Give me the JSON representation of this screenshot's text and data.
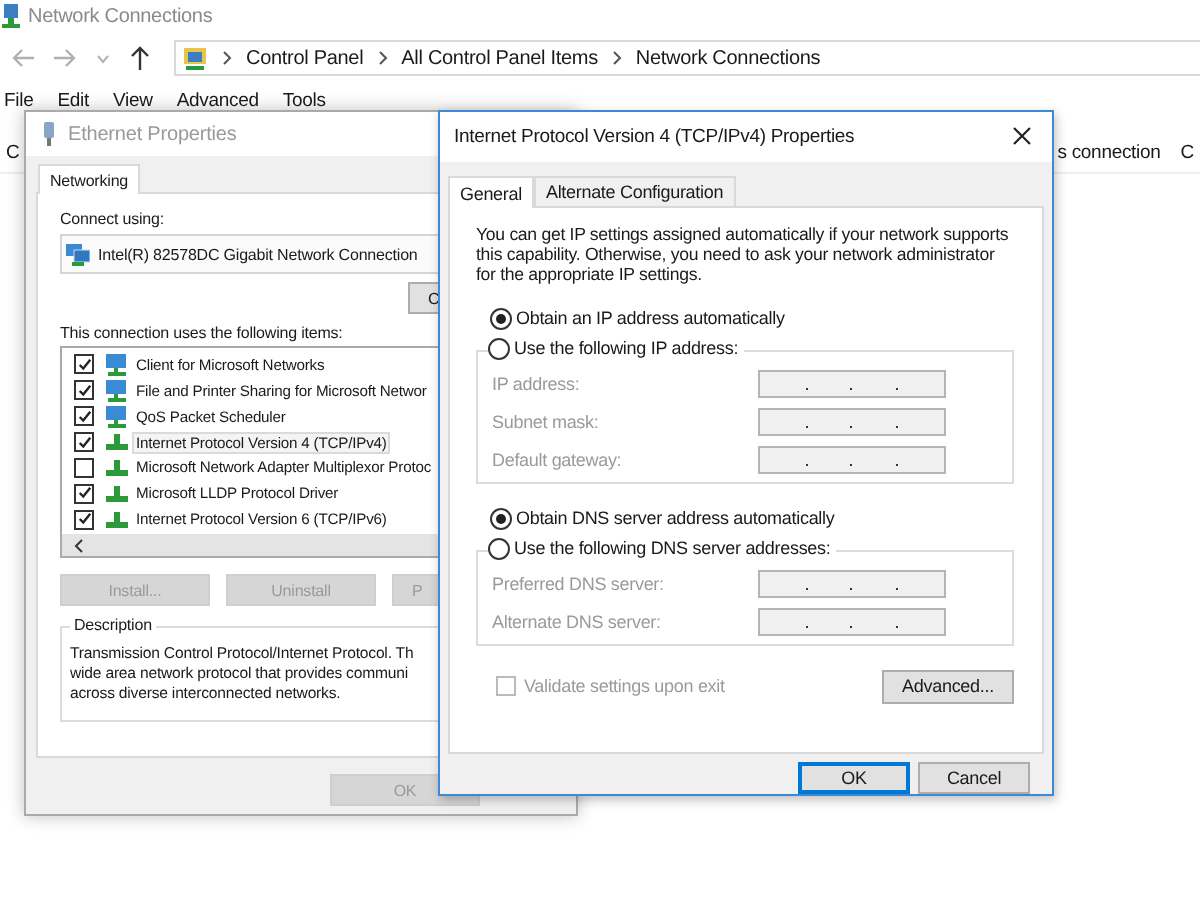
{
  "explorer": {
    "title": "Network Connections",
    "breadcrumb": [
      "Control Panel",
      "All Control Panel Items",
      "Network Connections"
    ],
    "menu": [
      "File",
      "Edit",
      "View",
      "Advanced",
      "Tools"
    ],
    "toolbar_left": "C",
    "toolbar_right": [
      "s connection",
      "C"
    ]
  },
  "ethernet_dialog": {
    "title": "Ethernet Properties",
    "tabs": [
      {
        "label": "Networking",
        "selected": true
      }
    ],
    "connect_label": "Connect using:",
    "adapter": "Intel(R) 82578DC Gigabit Network Connection",
    "configure_button": "C",
    "items_label": "This connection uses the following items:",
    "items": [
      {
        "kind": "service",
        "label": "Client for Microsoft Networks",
        "checked": true,
        "selected": false
      },
      {
        "kind": "service",
        "label": "File and Printer Sharing for Microsoft Networ",
        "checked": true,
        "selected": false
      },
      {
        "kind": "service",
        "label": "QoS Packet Scheduler",
        "checked": true,
        "selected": false
      },
      {
        "kind": "protocol",
        "label": "Internet Protocol Version 4 (TCP/IPv4)",
        "checked": true,
        "selected": true
      },
      {
        "kind": "protocol",
        "label": "Microsoft Network Adapter Multiplexor Protoc",
        "checked": false,
        "selected": false
      },
      {
        "kind": "protocol",
        "label": "Microsoft LLDP Protocol Driver",
        "checked": true,
        "selected": false
      },
      {
        "kind": "protocol",
        "label": "Internet Protocol Version 6 (TCP/IPv6)",
        "checked": true,
        "selected": false
      }
    ],
    "buttons": [
      {
        "label": "Install...",
        "disabled": true
      },
      {
        "label": "Uninstall",
        "disabled": true
      },
      {
        "label": "P",
        "disabled": true
      }
    ],
    "description_title": "Description",
    "description": [
      "Transmission Control Protocol/Internet Protocol. Th",
      "wide area network protocol that provides communi",
      "across diverse interconnected networks."
    ],
    "ok_button": {
      "label": "OK",
      "disabled": true
    }
  },
  "ipv4_dialog": {
    "title": "Internet Protocol Version 4 (TCP/IPv4) Properties",
    "tabs": [
      {
        "label": "General",
        "selected": true
      },
      {
        "label": "Alternate Configuration",
        "selected": false
      }
    ],
    "intro": "You can get IP settings assigned automatically if your network supports this capability. Otherwise, you need to ask your network administrator for the appropriate IP settings.",
    "ip_options": [
      {
        "label": "Obtain an IP address automatically",
        "selected": true
      },
      {
        "label": "Use the following IP address:",
        "selected": false
      }
    ],
    "ip_fields": [
      {
        "label": "IP address:",
        "disabled": true
      },
      {
        "label": "Subnet mask:",
        "disabled": true
      },
      {
        "label": "Default gateway:",
        "disabled": true
      }
    ],
    "dns_options": [
      {
        "label": "Obtain DNS server address automatically",
        "selected": true
      },
      {
        "label": "Use the following DNS server addresses:",
        "selected": false
      }
    ],
    "dns_fields": [
      {
        "label": "Preferred DNS server:",
        "disabled": true
      },
      {
        "label": "Alternate DNS server:",
        "disabled": true
      }
    ],
    "validate": {
      "label": "Validate settings upon exit",
      "checked": false,
      "disabled": true
    },
    "advanced_button": "Advanced...",
    "buttons": [
      {
        "label": "OK",
        "default": true
      },
      {
        "label": "Cancel",
        "default": false
      }
    ]
  }
}
